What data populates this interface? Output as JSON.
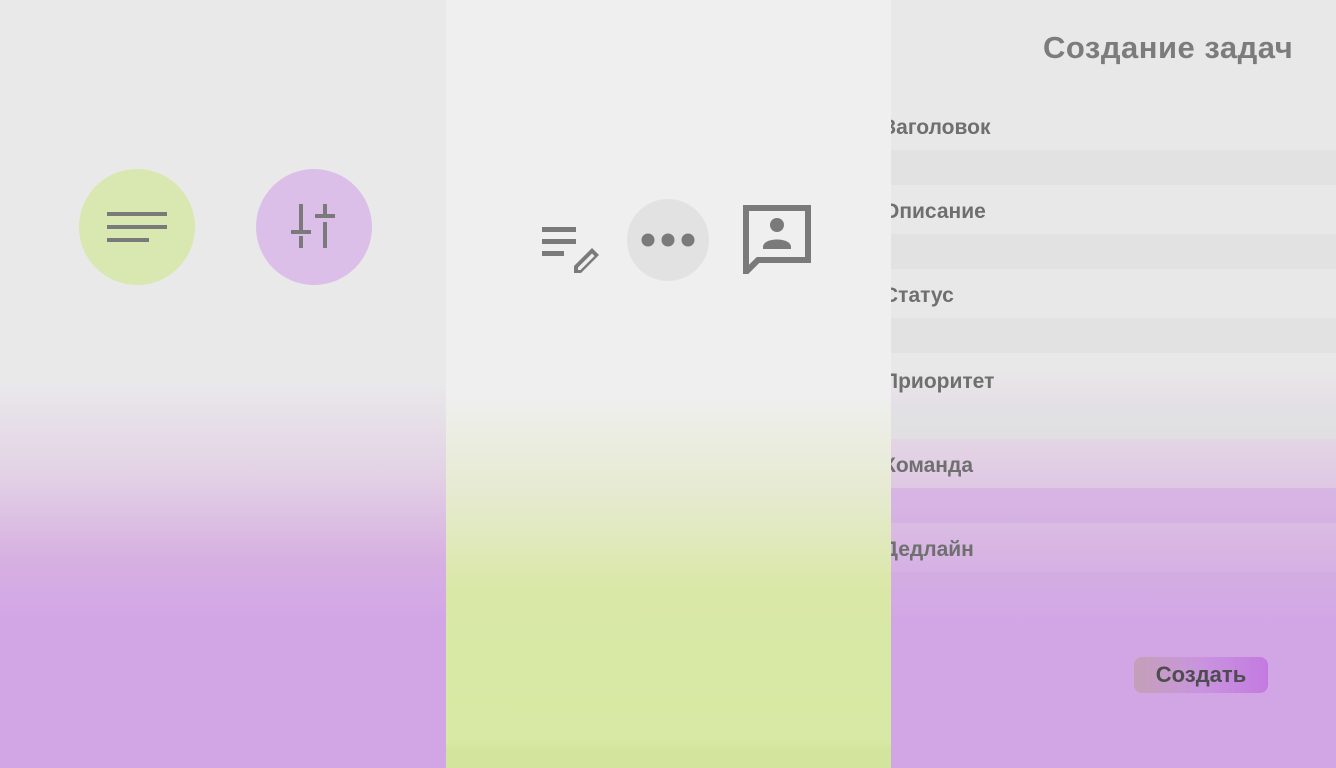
{
  "toolbar_left": {
    "buttons": [
      {
        "name": "menu-button",
        "icon": "menu-lines-icon",
        "color": "#d9e7b0"
      },
      {
        "name": "filter-button",
        "icon": "sliders-icon",
        "color": "#dbbfe8"
      }
    ]
  },
  "toolbar_middle": {
    "icons": [
      "edit-list-icon",
      "more-horizontal-icon",
      "contact-message-icon"
    ]
  },
  "task_form": {
    "title": "Создание задач",
    "fields": [
      {
        "label": "Заголовок",
        "value": ""
      },
      {
        "label": "Описание",
        "value": ""
      },
      {
        "label": "Статус",
        "value": ""
      },
      {
        "label": "Приоритет",
        "value": ""
      },
      {
        "label": "Команда",
        "value": ""
      },
      {
        "label": "Дедлайн",
        "value": ""
      }
    ],
    "submit_label": "Создать"
  },
  "colors": {
    "accent_green": "#d9e7b0",
    "accent_purple": "#d2a6e5",
    "icon_gray": "#7a7a7a"
  }
}
